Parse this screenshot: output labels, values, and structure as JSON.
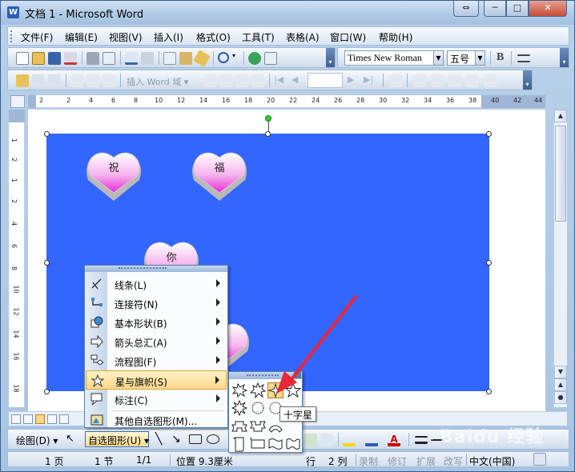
{
  "window": {
    "title": "文档 1 - Microsoft Word",
    "controls": [
      "⇔",
      "─",
      "□",
      "✕"
    ]
  },
  "menubar": {
    "items": [
      "文件(F)",
      "编辑(E)",
      "视图(V)",
      "插入(I)",
      "格式(O)",
      "工具(T)",
      "表格(A)",
      "窗口(W)",
      "帮助(H)"
    ]
  },
  "format_toolbar": {
    "font_name": "Times New Roman",
    "font_size": "五号",
    "bold_label": "B"
  },
  "mailmerge_toolbar": {
    "insert_field_label": "插入 Word 域 ▾"
  },
  "ruler": {
    "ticks": [
      "2",
      "2",
      "4",
      "6",
      "8",
      "10",
      "12",
      "14",
      "16",
      "18",
      "20",
      "22",
      "24",
      "26",
      "28",
      "30",
      "32",
      "34",
      "36",
      "38",
      "40",
      "42",
      "44"
    ],
    "vticks": [
      "1",
      "2",
      "1",
      "2",
      "4",
      "6",
      "8",
      "10",
      "12",
      "14",
      "16",
      "18"
    ]
  },
  "canvas": {
    "background": "#3366ff",
    "hearts": [
      {
        "label": "祝"
      },
      {
        "label": "福"
      },
      {
        "label": "你"
      },
      {
        "label": ""
      }
    ]
  },
  "autoshapes_menu": {
    "items": [
      {
        "label": "线条(L)",
        "icon": "lines-icon",
        "has_submenu": true
      },
      {
        "label": "连接符(N)",
        "icon": "connector-icon",
        "has_submenu": true
      },
      {
        "label": "基本形状(B)",
        "icon": "basic-shapes-icon",
        "has_submenu": true
      },
      {
        "label": "箭头总汇(A)",
        "icon": "block-arrows-icon",
        "has_submenu": true
      },
      {
        "label": "流程图(F)",
        "icon": "flowchart-icon",
        "has_submenu": true
      },
      {
        "label": "星与旗帜(S)",
        "icon": "stars-banners-icon",
        "has_submenu": true,
        "highlighted": true
      },
      {
        "label": "标注(C)",
        "icon": "callouts-icon",
        "has_submenu": true
      },
      {
        "label": "其他自选图形(M)...",
        "icon": "more-autoshapes-icon",
        "has_submenu": false
      }
    ]
  },
  "stars_menu": {
    "tooltip": "十字星",
    "highlighted_shape": "4-point-star"
  },
  "drawing_toolbar": {
    "draw_label": "绘图(D) ▾",
    "autoshapes_label": "自选图形(U) ▾"
  },
  "statusbar": {
    "page": "1 页",
    "section": "1 节",
    "page_of": "1/1",
    "position": "位置 9.3厘米",
    "line": "行",
    "column": "2 列",
    "rec": "录制",
    "trk": "修订",
    "ext": "扩展",
    "ovr": "改写",
    "language": "中文(中国)"
  },
  "watermark": "Baidu 经验",
  "colors": {
    "canvas_blue": "#3366ff",
    "menu_highlight": "#ffd78a",
    "annotation_arrow": "#e8263a"
  }
}
